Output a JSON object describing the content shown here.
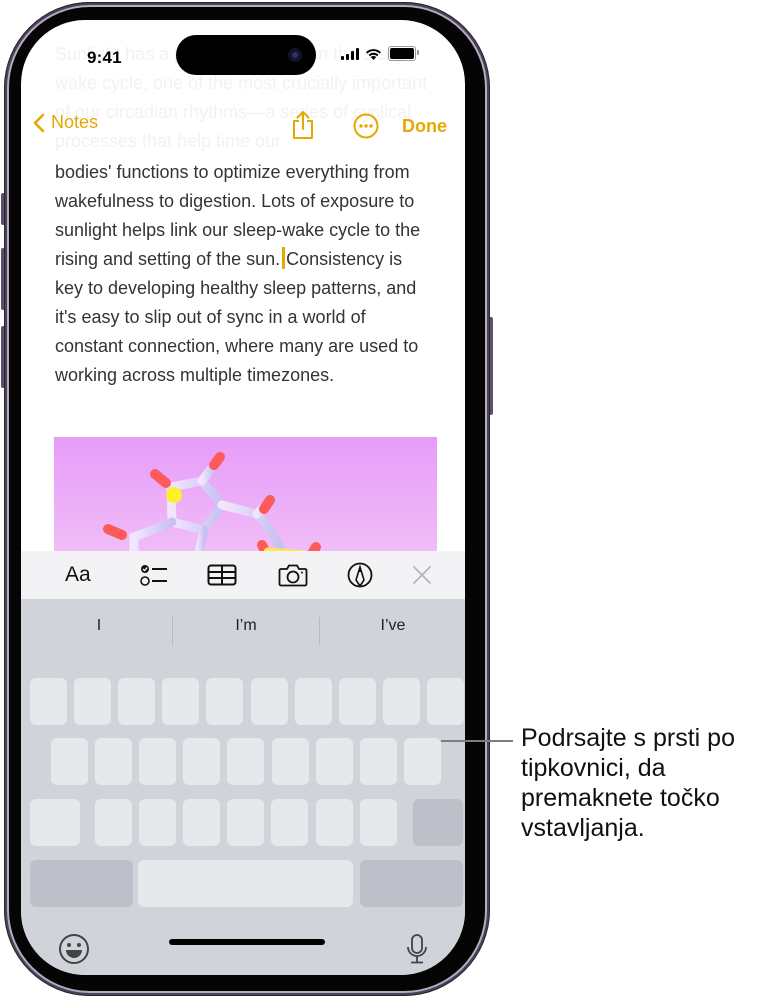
{
  "status_bar": {
    "time": "9:41"
  },
  "nav": {
    "back_label": "Notes",
    "done_label": "Done"
  },
  "note": {
    "faded_text": "Sunlight has a profound impact on the sleep-wake cycle, one of the most crucially important of our circadian rhythms—a series of cyclical processes that help time our",
    "text_before_cursor": "bodies' functions to optimize everything from wakefulness to digestion. Lots of exposure to sunlight helps link our sleep-wake cycle to the rising and setting of the sun.",
    "text_after_cursor": "Consistency is key to developing healthy sleep patterns, and it's easy to slip out of sync in a world of constant connection, where many are used to working across multiple timezones.",
    "accent_color": "#e6a800"
  },
  "format_bar": {
    "text_style_label": "Aa",
    "icons": [
      "checklist-icon",
      "table-icon",
      "camera-icon",
      "markup-icon",
      "close-icon"
    ]
  },
  "keyboard": {
    "predictions": [
      "I",
      "I’m",
      "I’ve"
    ]
  },
  "callout": {
    "text": "Podrsajte s prsti po tipkovnici, da premaknete točko vstavljanja."
  }
}
